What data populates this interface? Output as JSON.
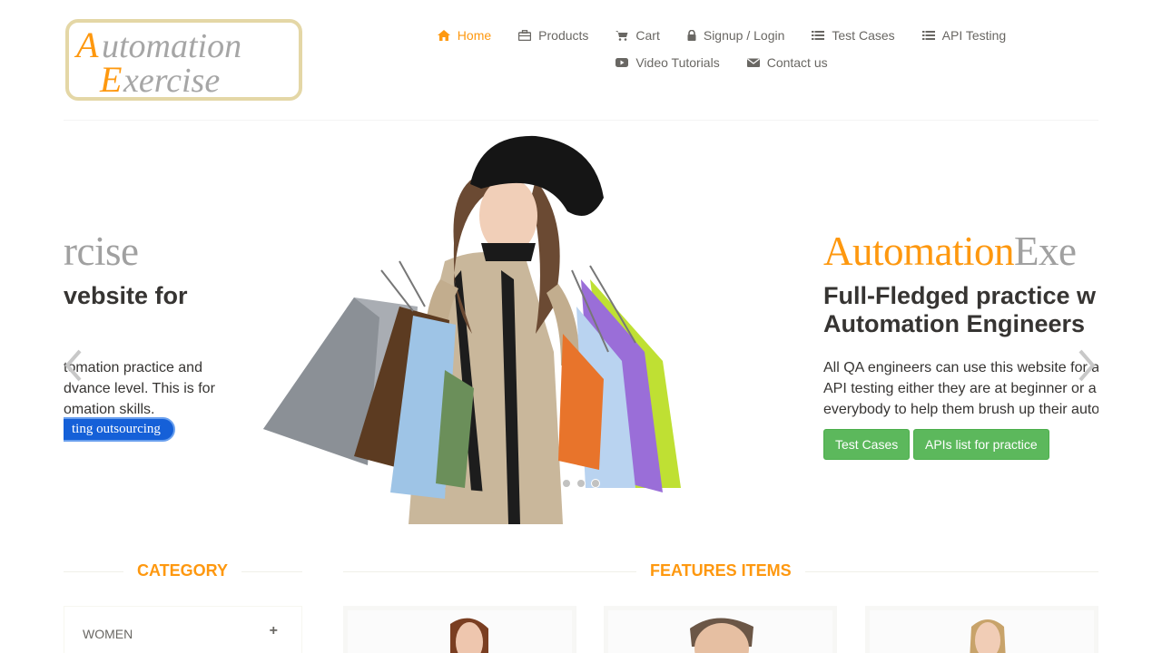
{
  "header": {
    "logo_text_1": "Automation",
    "logo_text_2": "Exercise",
    "nav": [
      {
        "label": "Home",
        "icon": "home-icon",
        "active": true
      },
      {
        "label": "Products",
        "icon": "briefcase-icon"
      },
      {
        "label": "Cart",
        "icon": "cart-icon"
      },
      {
        "label": "Signup / Login",
        "icon": "lock-icon"
      },
      {
        "label": "Test Cases",
        "icon": "list-icon"
      },
      {
        "label": "API Testing",
        "icon": "list-icon"
      },
      {
        "label": "Video Tutorials",
        "icon": "youtube-icon"
      },
      {
        "label": "Contact us",
        "icon": "envelope-icon"
      }
    ]
  },
  "carousel": {
    "prev_slide": {
      "title_part": "rcise",
      "heading_part": "vebsite for",
      "text_lines": [
        "tomation practice and",
        "dvance level. This is for",
        "omation skills."
      ],
      "pill_label": "ting outsourcing"
    },
    "next_slide": {
      "title_1": "Automation",
      "title_2": "Exe",
      "heading_lines": [
        "Full-Fledged practice w",
        "Automation Engineers"
      ],
      "text_lines": [
        "All QA engineers can use this website for a",
        "API testing either they are at beginner or a",
        "everybody to help them brush up their auto"
      ],
      "button_1": "Test Cases",
      "button_2": "APIs list for practice"
    },
    "indicator_count": 3
  },
  "sidebar": {
    "title": "CATEGORY",
    "categories": [
      {
        "label": "WOMEN"
      }
    ]
  },
  "features": {
    "title": "FEATURES ITEMS"
  },
  "colors": {
    "accent": "#fe980f",
    "green": "#5cb85c",
    "text": "#696763",
    "dark": "#363432"
  }
}
